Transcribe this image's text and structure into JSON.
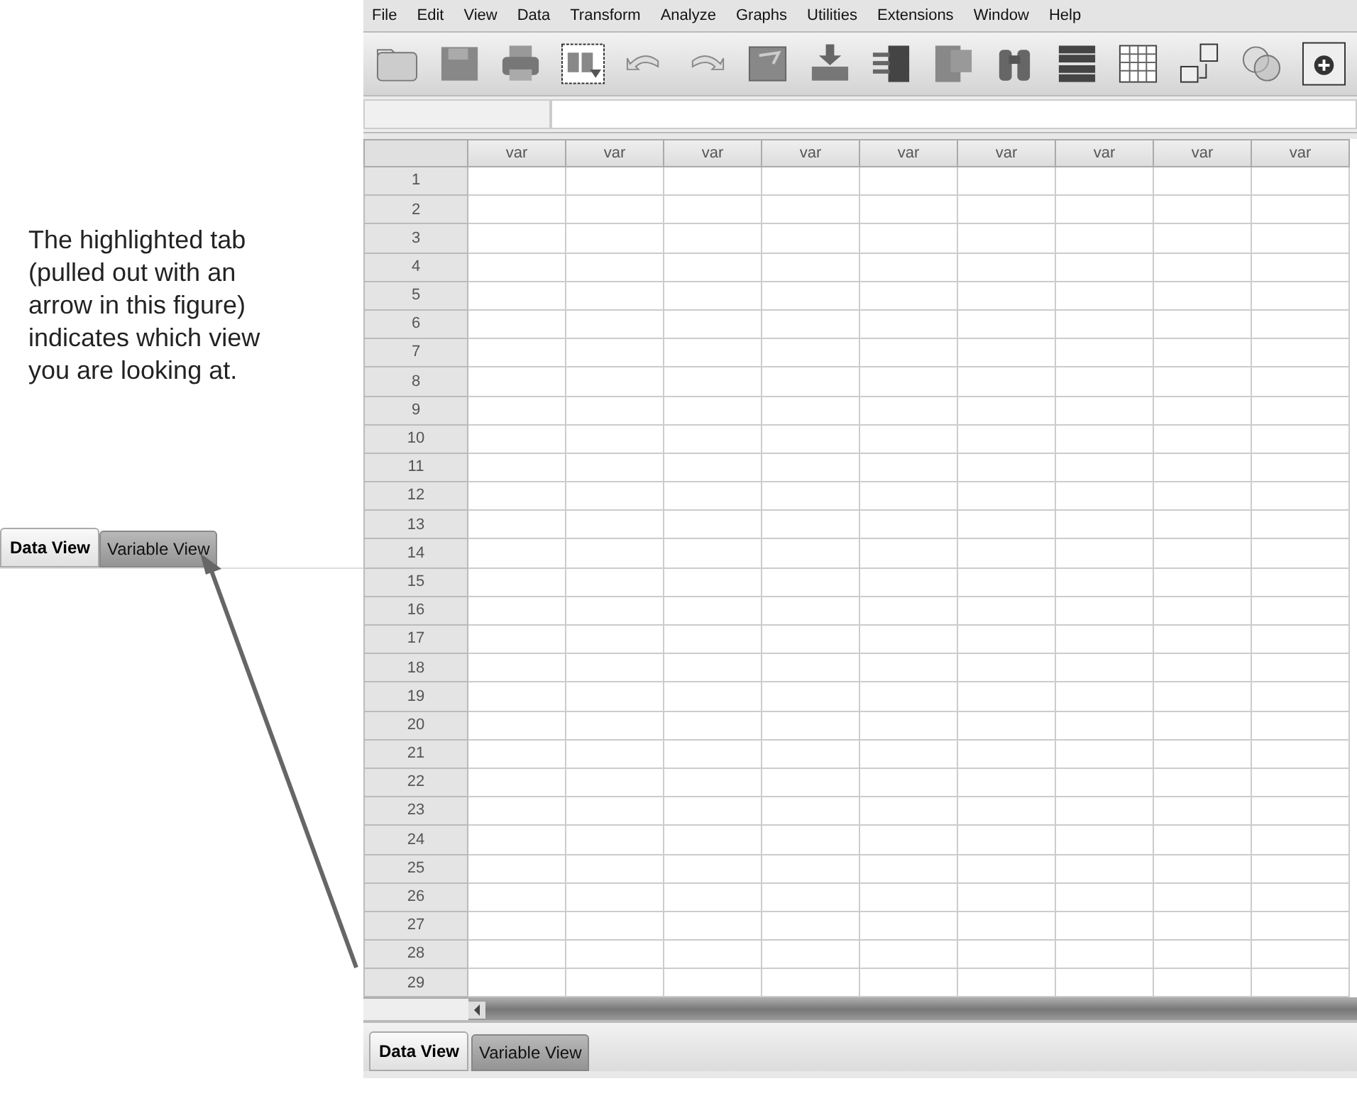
{
  "annotation": "The highlighted tab (pulled out with an arrow in this figure) indicates which view you are looking at.",
  "callout_tabs": [
    {
      "label": "Data View",
      "selected": true
    },
    {
      "label": "Variable View",
      "selected": false
    }
  ],
  "menu": [
    "File",
    "Edit",
    "View",
    "Data",
    "Transform",
    "Analyze",
    "Graphs",
    "Utilities",
    "Extensions",
    "Window",
    "Help"
  ],
  "columns": [
    "var",
    "var",
    "var",
    "var",
    "var",
    "var",
    "var",
    "var",
    "var"
  ],
  "rows": [
    "1",
    "2",
    "3",
    "4",
    "5",
    "6",
    "7",
    "8",
    "9",
    "10",
    "11",
    "12",
    "13",
    "14",
    "15",
    "16",
    "17",
    "18",
    "19",
    "20",
    "21",
    "22",
    "23",
    "24",
    "25",
    "26",
    "27",
    "28",
    "29"
  ],
  "tabs": [
    {
      "label": "Data View",
      "selected": true
    },
    {
      "label": "Variable View",
      "selected": false
    }
  ]
}
